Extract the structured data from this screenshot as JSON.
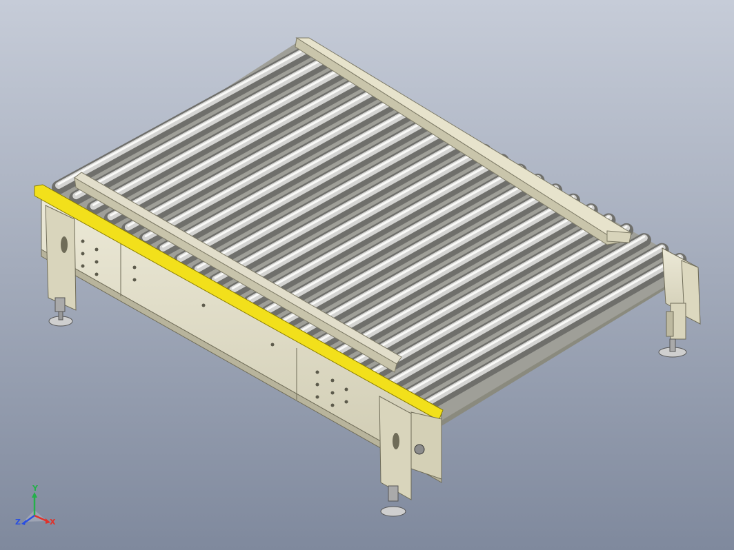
{
  "viewport": {
    "background_top": "#c6ccd8",
    "background_bottom": "#7f899d"
  },
  "model": {
    "frame_color": "#e3dfc9",
    "frame_shadow": "#9a967f",
    "roller_color": "#d4d4d2",
    "selected_edge_color": "#f2e01b",
    "roller_count": 22
  },
  "triad": {
    "x_label": "X",
    "y_label": "Y",
    "z_label": "Z",
    "x_color": "#e0322a",
    "y_color": "#24b04a",
    "z_color": "#2a4fe0"
  }
}
